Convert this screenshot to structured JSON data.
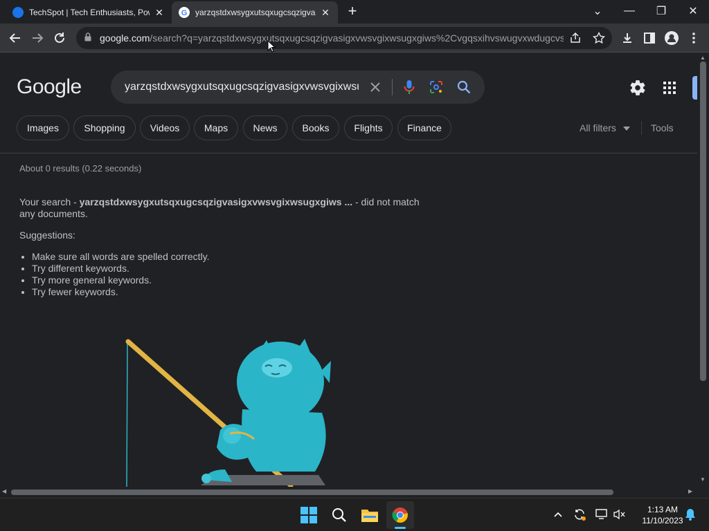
{
  "tabs": [
    {
      "title": "TechSpot | Tech Enthusiasts, Pow",
      "close": "✕"
    },
    {
      "title": "yarzqstdxwsygxutsqxugcsqzigva",
      "close": "✕"
    }
  ],
  "new_tab_label": "+",
  "window_controls": {
    "tab_search": "⌄",
    "minimize": "—",
    "restore": "❐",
    "close": "✕"
  },
  "address_bar": {
    "host": "google.com",
    "path": "/search?q=yarzqstdxwsygxutsqxugcsqzigvasigxvwsvgixwsugxgiws%2Cvgqsxihvswugvxwdugcvs..."
  },
  "google": {
    "logo_text": "Google",
    "search_value": "yarzqstdxwsygxutsqxugcsqzigvasigxvwsvgixwsugxgiws",
    "chips": [
      "Images",
      "Shopping",
      "Videos",
      "Maps",
      "News",
      "Books",
      "Flights",
      "Finance"
    ],
    "all_filters": "All filters",
    "tools": "Tools",
    "result_stats": "About 0 results (0.22 seconds)",
    "no_match_prefix": "Your search - ",
    "no_match_query": "yarzqstdxwsygxutsqxugcsqzigvasigxvwsvgixwsugxgiws ...",
    "no_match_suffix": " - did not match any documents.",
    "suggestions_title": "Suggestions:",
    "suggestions": [
      "Make sure all words are spelled correctly.",
      "Try different keywords.",
      "Try more general keywords.",
      "Try fewer keywords."
    ]
  },
  "taskbar": {
    "time": "1:13 AM",
    "date": "11/10/2023"
  },
  "colors": {
    "background": "#202124",
    "mascot": "#2bb5c9",
    "rod": "#e2b444",
    "mic_blue": "#4285f4",
    "search_icon": "#8ab4f8"
  }
}
